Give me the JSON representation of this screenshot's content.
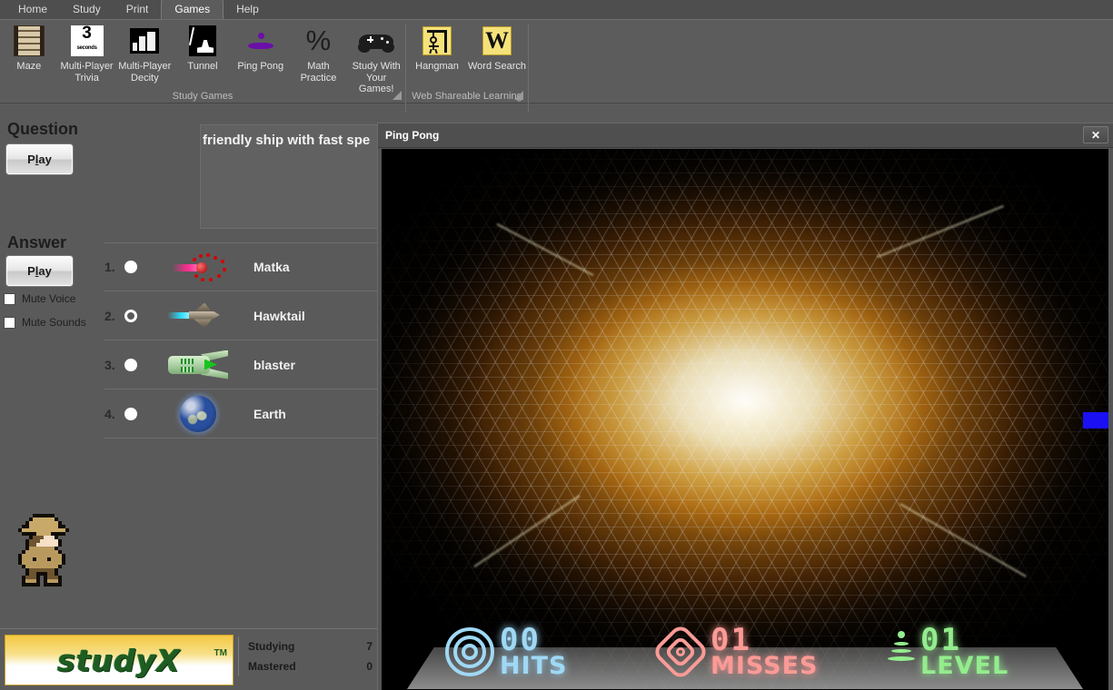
{
  "window": {
    "tabs": [
      {
        "label": "Home",
        "active": false
      },
      {
        "label": "Study",
        "active": false
      },
      {
        "label": "Print",
        "active": false
      },
      {
        "label": "Games",
        "active": true
      },
      {
        "label": "Help",
        "active": false
      }
    ]
  },
  "ribbon": {
    "groups": [
      {
        "label": "Study Games",
        "items": [
          {
            "label": "Maze",
            "icon": "maze-icon"
          },
          {
            "label": "Multi-Player Trivia",
            "icon": "trivia-timer-icon",
            "badge": "3",
            "badge_sub": "seconds"
          },
          {
            "label": "Multi-Player Decity",
            "icon": "city-buildings-icon"
          },
          {
            "label": "Tunnel",
            "icon": "tunnel-icon"
          },
          {
            "label": "Ping Pong",
            "icon": "ping-pong-paddle-icon"
          },
          {
            "label": "Math Practice",
            "icon": "percent-icon"
          },
          {
            "label": "Study With Your Games!",
            "icon": "gamepad-icon"
          }
        ]
      },
      {
        "label": "Web Shareable Learning",
        "items": [
          {
            "label": "Hangman",
            "icon": "hangman-icon"
          },
          {
            "label": "Word Search",
            "icon": "word-search-w-icon"
          }
        ]
      }
    ]
  },
  "left_panel": {
    "question_heading": "Question",
    "question_play_label": "Play",
    "question_text": "friendly ship with fast spe",
    "answer_heading": "Answer",
    "answer_play_label": "Play",
    "mute_voice_label": "Mute Voice",
    "mute_sounds_label": "Mute Sounds",
    "mute_voice_checked": false,
    "mute_sounds_checked": false,
    "answers": [
      {
        "number": "1.",
        "name": "Matka",
        "thumb": "matka-ship-thumbnail",
        "selected": false
      },
      {
        "number": "2.",
        "name": "Hawktail",
        "thumb": "hawktail-ship-thumbnail",
        "selected": true
      },
      {
        "number": "3.",
        "name": "blaster",
        "thumb": "blaster-ship-thumbnail",
        "selected": false
      },
      {
        "number": "4.",
        "name": "Earth",
        "thumb": "earth-planet-thumbnail",
        "selected": false
      }
    ],
    "avatar": "explorer-character-sprite"
  },
  "status_bar": {
    "logo_text": "studyX",
    "trademark": "TM",
    "stats": [
      {
        "label": "Studying",
        "value": "7"
      },
      {
        "label": "Mastered",
        "value": "0"
      }
    ]
  },
  "game": {
    "title": "Ping Pong",
    "close_label": "✕",
    "hud": [
      {
        "label": "HITS",
        "value": "00",
        "color": "#9fd8f5",
        "icon": "target-rings-icon"
      },
      {
        "label": "MISSES",
        "value": "01",
        "color": "#fb9a96",
        "icon": "miss-burst-icon"
      },
      {
        "label": "LEVEL",
        "value": "01",
        "color": "#93ec8d",
        "icon": "level-cone-icon"
      }
    ],
    "paddle_color": "#1a10f2"
  },
  "colors": {
    "chrome": "#5a5a5a",
    "ribbon": "#5c5c5c",
    "tab_active": "#5c5c5c",
    "accent_blue": "#1a10f2",
    "logo_green": "#1f5c22",
    "logo_gold": "#f5c842"
  }
}
